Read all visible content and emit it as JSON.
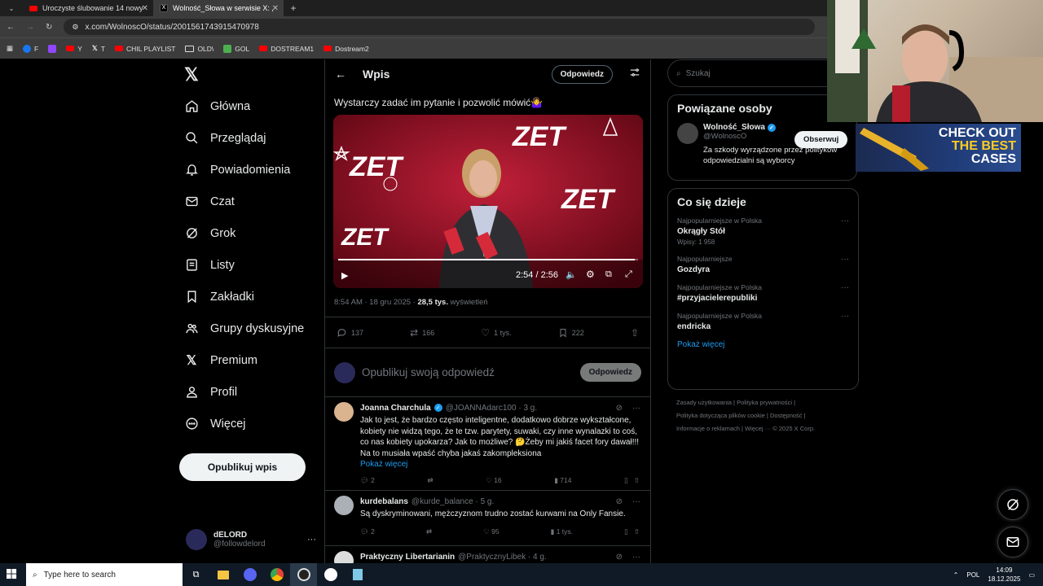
{
  "browser": {
    "tabs": [
      {
        "label": "Uroczyste ślubowanie 14 nowy"
      },
      {
        "label": "Wolność_Słowa w serwisie X: ,"
      }
    ],
    "url": "x.com/WolnoscO/status/2001561743915470978",
    "bookmarks": [
      "F",
      "Y",
      "T",
      "CHIL PLAYLIST",
      "OLD\\",
      "GOL",
      "DOSTREAM1",
      "Dostream2"
    ]
  },
  "nav": {
    "items": [
      "Główna",
      "Przeglądaj",
      "Powiadomienia",
      "Czat",
      "Grok",
      "Listy",
      "Zakładki",
      "Grupy dyskusyjne",
      "Premium",
      "Profil",
      "Więcej"
    ],
    "post_button": "Opublikuj wpis",
    "profile_name": "dELORD",
    "profile_handle": "@followdelord"
  },
  "post": {
    "header_title": "Wpis",
    "reply_pill": "Odpowiedz",
    "text": "Wystarczy zadać im pytanie i pozwolić mówić🤷‍♀️",
    "video_time": "2:54 / 2:56",
    "video_progress": 0.988,
    "time": "8:54 AM · 18 gru 2025 · ",
    "views": "28,5 tys.",
    "views_label": " wyświetleń",
    "replies": "137",
    "reposts": "166",
    "likes": "1 tys.",
    "bookmarks": "222"
  },
  "composer": {
    "placeholder": "Opublikuj swoją odpowiedź",
    "button": "Odpowiedz"
  },
  "replies": [
    {
      "name": "Joanna Charchula",
      "handle": "@JOANNAdarc100 · 3 g.",
      "text": "Jak to jest, że bardzo często inteligentne, dodatkowo dobrze wykształcone, kobiety nie widzą tego, że te tzw. parytety, suwaki, czy inne wynalazki to coś, co nas kobiety upokarza? Jak to możliwe? 🤔Żeby mi jakiś facet fory dawał!!! Na to musiała wpaść chyba jakaś zakompleksiona",
      "more": "Pokaż więcej",
      "replies": "2",
      "reposts": "",
      "likes": "16",
      "views": "714"
    },
    {
      "name": "kurdebalans",
      "handle": "@kurde_balance · 5 g.",
      "text": "Są dyskryminowani, mężczyznom trudno zostać kurwami na Only Fansie.",
      "replies": "2",
      "reposts": "",
      "likes": "95",
      "views": "1 tys."
    },
    {
      "name": "Praktyczny Libertarianin",
      "handle": "@PraktycznyLibek · 4 g."
    }
  ],
  "right": {
    "search_placeholder": "Szukaj",
    "related_title": "Powiązane osoby",
    "related_name": "Wolność_Słowa",
    "related_handle": "@WolnoscO",
    "follow": "Obserwuj",
    "related_bio": "Za szkody wyrządzone przez polityków odpowiedzialni są wyborcy",
    "trends_title": "Co się dzieje",
    "trends": [
      {
        "cat": "Najpopularniejsze w Polska",
        "name": "Okrągły Stół",
        "count": "Wpisy: 1 958"
      },
      {
        "cat": "Najpopularniejsze",
        "name": "Gozdyra",
        "count": ""
      },
      {
        "cat": "Najpopularniejsze w Polska",
        "name": "#przyjacielerepubliki",
        "count": ""
      },
      {
        "cat": "Najpopularniejsze w Polska",
        "name": "endricka",
        "count": ""
      }
    ],
    "show_more": "Pokaż więcej",
    "footer": [
      "Zasady użytkowania",
      "Polityka prywatności",
      "Polityka dotycząca plików cookie",
      "Dostępność",
      "Informacje o reklamach",
      "Więcej ···",
      "© 2025 X Corp."
    ]
  },
  "ad": {
    "line1": "CHECK OUT",
    "line2": "THE BEST",
    "line3": "CASES"
  },
  "taskbar": {
    "search": "Type here to search",
    "lang": "POL",
    "time": "14:09",
    "date": "18.12.2025"
  }
}
